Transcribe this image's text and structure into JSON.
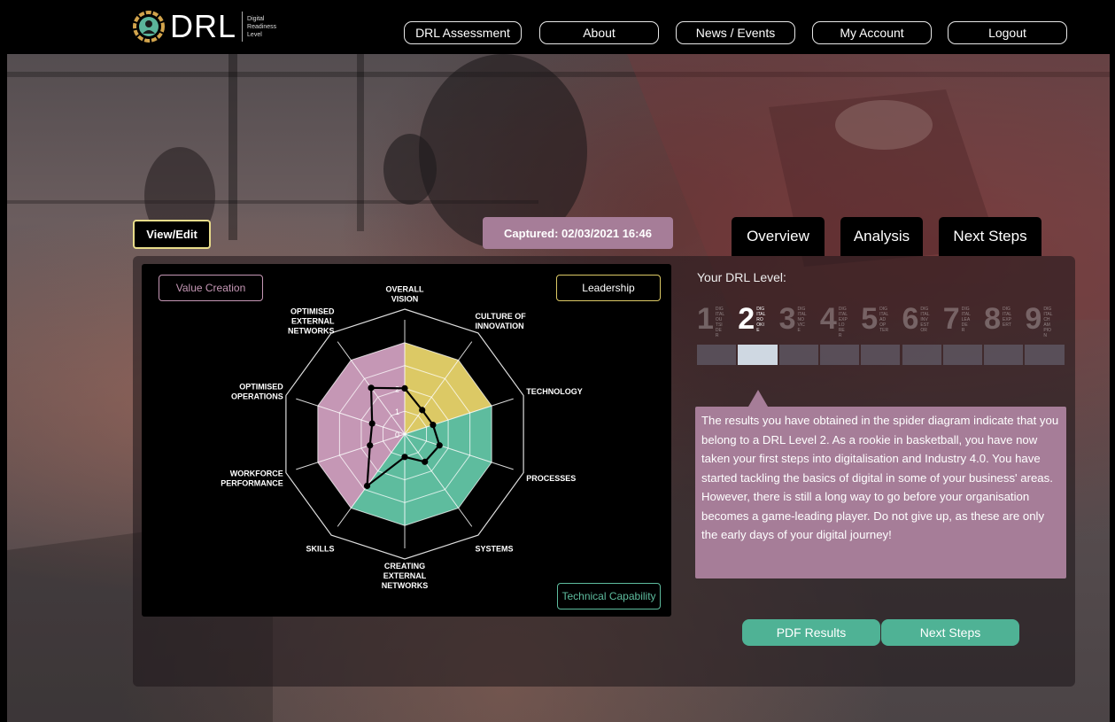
{
  "brand": {
    "name": "DRL",
    "subtitle": [
      "Digital",
      "Readiness",
      "Level"
    ]
  },
  "nav": [
    {
      "label": "DRL Assessment"
    },
    {
      "label": "About"
    },
    {
      "label": "News / Events"
    },
    {
      "label": "My Account"
    },
    {
      "label": "Logout"
    }
  ],
  "view_edit_label": "View/Edit",
  "captured_label": "Captured: 02/03/2021 16:46",
  "tabs": [
    {
      "label": "Overview",
      "active": true
    },
    {
      "label": "Analysis",
      "active": false
    },
    {
      "label": "Next Steps",
      "active": false
    }
  ],
  "legend": {
    "value_creation": "Value Creation",
    "leadership": "Leadership",
    "technical_capability": "Technical Capability"
  },
  "colors": {
    "value_creation": "#c597b5",
    "leadership": "#dcc965",
    "technical_capability": "#5ebc9e",
    "accent_purple": "#a67d98",
    "accent_green": "#4fb295"
  },
  "chart_data": {
    "type": "radar",
    "axes": [
      "OVERALL VISION",
      "CULTURE OF INNOVATION",
      "TECHNOLOGY",
      "PROCESSES",
      "SYSTEMS",
      "CREATING EXTERNAL NETWORKS",
      "SKILLS",
      "WORKFORCE PERFORMANCE",
      "OPTIMISED OPERATIONS",
      "OPTIMISED EXTERNAL NETWORKS"
    ],
    "axis_label_lines": [
      [
        "OVERALL",
        "VISION"
      ],
      [
        "CULTURE OF",
        "INNOVATION"
      ],
      [
        "TECHNOLOGY"
      ],
      [
        "PROCESSES"
      ],
      [
        "SYSTEMS"
      ],
      [
        "CREATING",
        "EXTERNAL",
        "NETWORKS"
      ],
      [
        "SKILLS"
      ],
      [
        "WORKFORCE",
        "PERFORMANCE"
      ],
      [
        "OPTIMISED",
        "OPERATIONS"
      ],
      [
        "OPTIMISED",
        "EXTERNAL",
        "NETWORKS"
      ]
    ],
    "r_ticks": [
      "0",
      "1",
      "2"
    ],
    "r_max": 5,
    "category_fill_level": 4,
    "axis_categories": [
      "leadership",
      "leadership",
      "technical_capability",
      "technical_capability",
      "technical_capability",
      "technical_capability",
      "value_creation",
      "value_creation",
      "value_creation",
      "value_creation"
    ],
    "series": [
      {
        "values": [
          2.0,
          1.3,
          1.3,
          1.6,
          1.5,
          1.0,
          2.8,
          1.6,
          1.5,
          2.5
        ]
      }
    ]
  },
  "drl_label": "Your DRL Level:",
  "levels": [
    {
      "num": "1",
      "tag": "DIGITAL OUTSIDER"
    },
    {
      "num": "2",
      "tag": "DIGITAL ROOKIE"
    },
    {
      "num": "3",
      "tag": "DIGITAL NOVICE"
    },
    {
      "num": "4",
      "tag": "DIGITAL EXPLORER"
    },
    {
      "num": "5",
      "tag": "DIGITAL ADOPTER"
    },
    {
      "num": "6",
      "tag": "DIGITAL INVESTOR"
    },
    {
      "num": "7",
      "tag": "DIGITAL LEADER"
    },
    {
      "num": "8",
      "tag": "DIGITAL EXPERT"
    },
    {
      "num": "9",
      "tag": "DIGITAL CHAMPION"
    }
  ],
  "current_level": 2,
  "description": "The results you have obtained in the spider diagram indicate that you belong to a DRL Level 2. As a rookie in basketball, you have now taken your first steps into digitalisation and Industry 4.0. You have started tackling the basics of digital in some of your business' areas. However, there is still a long way to go before your organisation becomes a game-leading player. Do not give up, as these are only the early days of your digital journey!",
  "actions": {
    "pdf_label": "PDF Results",
    "next_label": "Next Steps"
  }
}
